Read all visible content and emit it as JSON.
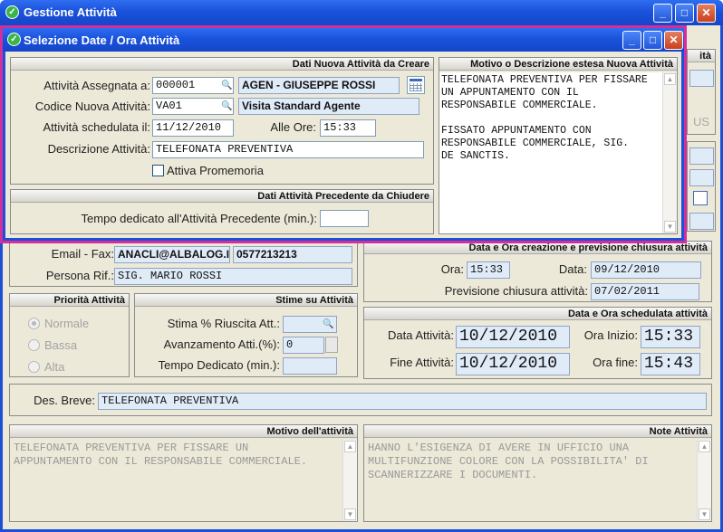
{
  "main": {
    "title": "Gestione Attività",
    "right_cut": {
      "a": "ità",
      "b": "US"
    },
    "contact": {
      "email_label": "Email - Fax:",
      "email": "ANACLI@ALBALOG.IT",
      "fax": "0577213213",
      "persona_label": "Persona Rif.:",
      "persona": "SIG. MARIO ROSSI"
    },
    "creazione": {
      "header": "Data e Ora creazione e previsione chiusura attività",
      "ora_label": "Ora:",
      "ora": "15:33",
      "data_label": "Data:",
      "data": "09/12/2010",
      "prev_label": "Previsione chiusura attività:",
      "prev": "07/02/2011"
    },
    "priorita": {
      "header": "Priorità Attività",
      "options": [
        "Normale",
        "Bassa",
        "Alta"
      ]
    },
    "stime": {
      "header": "Stime su Attività",
      "riuscita_label": "Stima % Riuscita Att.:",
      "avanzamento_label": "Avanzamento Atti.(%):",
      "avanzamento": "0",
      "tempo_label": "Tempo Dedicato (min.):"
    },
    "schedulata": {
      "header": "Data e Ora schedulata attività",
      "data_att_label": "Data Attività:",
      "data_att": "10/12/2010",
      "ora_inizio_label": "Ora Inizio:",
      "ora_inizio": "15:33",
      "fine_label": "Fine Attività:",
      "fine": "10/12/2010",
      "ora_fine_label": "Ora fine:",
      "ora_fine": "15:43"
    },
    "des_breve_label": "Des. Breve:",
    "des_breve": "TELEFONATA PREVENTIVA",
    "motivo": {
      "header": "Motivo dell'attività",
      "text": "TELEFONATA PREVENTIVA PER FISSARE UN\nAPPUNTAMENTO CON IL RESPONSABILE COMMERCIALE."
    },
    "note": {
      "header": "Note Attività",
      "text": "HANNO L'ESIGENZA DI AVERE IN UFFICIO UNA\nMULTIFUNZIONE COLORE CON LA POSSIBILITA' DI\nSCANNERIZZARE I DOCUMENTI."
    }
  },
  "modal": {
    "title": "Selezione Date / Ora Attività",
    "nuova": {
      "header": "Dati Nuova Attività da Creare",
      "assegnata_label": "Attività Assegnata a:",
      "assegnata_code": "000001",
      "assegnata_name": "AGEN - GIUSEPPE ROSSI",
      "codice_label": "Codice Nuova Attività:",
      "codice": "VA01",
      "codice_name": "Visita Standard Agente",
      "schedulata_label": "Attività schedulata il:",
      "schedulata": "11/12/2010",
      "alle_label": "Alle Ore:",
      "alle": "15:33",
      "descr_label": "Descrizione Attività:",
      "descr": "TELEFONATA PREVENTIVA",
      "promemoria_label": "Attiva Promemoria"
    },
    "precedente": {
      "header": "Dati Attività Precedente da  Chiudere",
      "tempo_label": "Tempo dedicato all'Attività Precedente (min.):",
      "tempo": ""
    },
    "motivo": {
      "header": "Motivo o Descrizione estesa Nuova Attività",
      "text": "TELEFONATA PREVENTIVA PER FISSARE\nUN APPUNTAMENTO CON IL\nRESPONSABILE COMMERCIALE.\n\nFISSATO APPUNTAMENTO CON\nRESPONSABILE COMMERCIALE, SIG.\nDE SANCTIS."
    }
  },
  "colors": {
    "titlebar": "#1a52dc",
    "highlight_border": "#d22f9d",
    "field_bg": "#e0ebf8"
  }
}
